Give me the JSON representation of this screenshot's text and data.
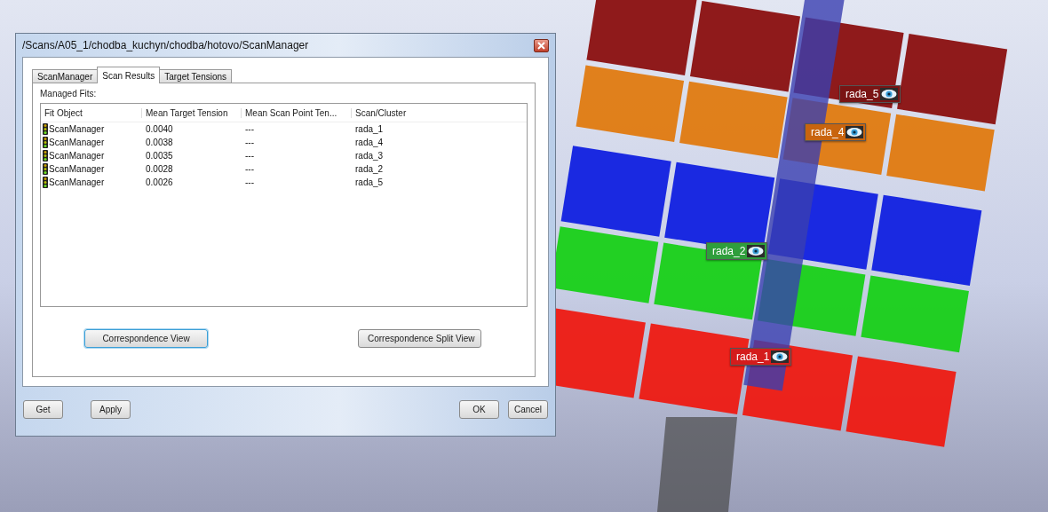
{
  "window": {
    "title": "/Scans/A05_1/chodba_kuchyn/chodba/hotovo/ScanManager"
  },
  "tabs": [
    {
      "label": "ScanManager",
      "selected": false
    },
    {
      "label": "Scan Results",
      "selected": true
    },
    {
      "label": "Target Tensions",
      "selected": false
    }
  ],
  "section_label": "Managed Fits:",
  "table": {
    "columns": [
      "Fit Object",
      "Mean Target Tension",
      "Mean Scan Point Ten...",
      "Scan/Cluster"
    ],
    "rows": [
      {
        "fit_object": "ScanManager",
        "mean_target_tension": "0.0040",
        "mean_scan_point_tension": "---",
        "scan_cluster": "rada_1"
      },
      {
        "fit_object": "ScanManager",
        "mean_target_tension": "0.0038",
        "mean_scan_point_tension": "---",
        "scan_cluster": "rada_4"
      },
      {
        "fit_object": "ScanManager",
        "mean_target_tension": "0.0035",
        "mean_scan_point_tension": "---",
        "scan_cluster": "rada_3"
      },
      {
        "fit_object": "ScanManager",
        "mean_target_tension": "0.0028",
        "mean_scan_point_tension": "---",
        "scan_cluster": "rada_2"
      },
      {
        "fit_object": "ScanManager",
        "mean_target_tension": "0.0026",
        "mean_scan_point_tension": "---",
        "scan_cluster": "rada_5"
      }
    ]
  },
  "view_buttons": [
    {
      "label": "Correspondence View",
      "focused": true
    },
    {
      "label": "Correspondence Split View",
      "focused": false
    }
  ],
  "bottom_buttons_left": [
    "Get",
    "Apply"
  ],
  "bottom_buttons_right": [
    "OK",
    "Cancel"
  ],
  "viewport": {
    "cluster_labels": [
      {
        "label": "rada_5",
        "color": "#7a1414"
      },
      {
        "label": "rada_4",
        "color": "#c8640e"
      },
      {
        "label": "rada_2",
        "color": "#2f9e3c"
      },
      {
        "label": "rada_1",
        "color": "#d41c1c"
      }
    ]
  }
}
